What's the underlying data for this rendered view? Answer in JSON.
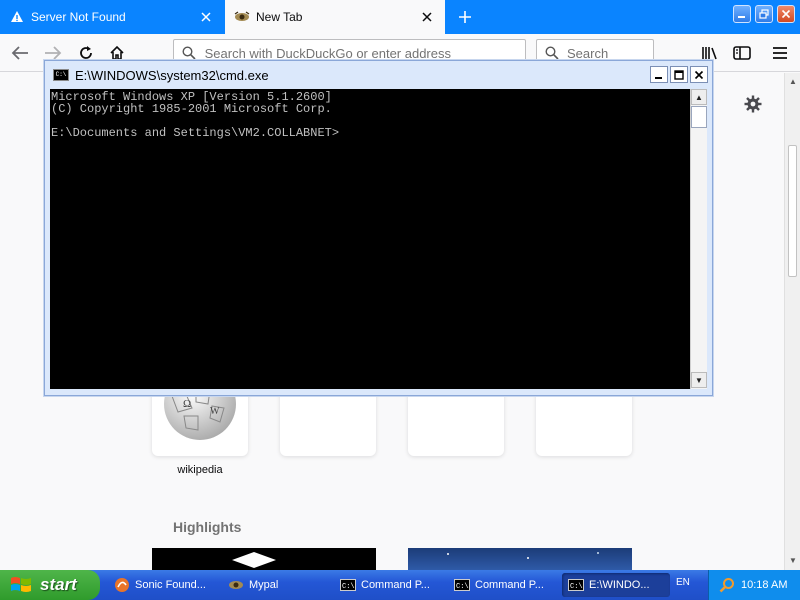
{
  "browser": {
    "tabs": [
      {
        "label": "Server Not Found",
        "icon": "warning-icon"
      },
      {
        "label": "New Tab",
        "icon": "newtab-favicon"
      }
    ],
    "urlbar_placeholder": "Search with DuckDuckGo or enter address",
    "searchbar_placeholder": "Search"
  },
  "newtab": {
    "top_sites": [
      {
        "label": "wikipedia",
        "icon": "wikipedia-globe-icon"
      },
      {
        "label": ""
      },
      {
        "label": ""
      },
      {
        "label": ""
      }
    ],
    "highlights_title": "Highlights"
  },
  "cmd": {
    "title": "E:\\WINDOWS\\system32\\cmd.exe",
    "icon_label": "C:\\",
    "lines": [
      "Microsoft Windows XP [Version 5.1.2600]",
      "(C) Copyright 1985-2001 Microsoft Corp.",
      "",
      "E:\\Documents and Settings\\VM2.COLLABNET>"
    ]
  },
  "taskbar": {
    "start_label": "start",
    "tasks": [
      {
        "label": "Sonic Found...",
        "icon": "sonic-foundry-icon"
      },
      {
        "label": "Mypal",
        "icon": "mypal-icon"
      },
      {
        "label": "Command P...",
        "icon": "cmd-icon"
      },
      {
        "label": "Command P...",
        "icon": "cmd-icon"
      },
      {
        "label": "E:\\WINDO...",
        "icon": "cmd-icon"
      }
    ],
    "language": "EN",
    "clock": "10:18 AM",
    "colors": {
      "taskbar": "#2457d6",
      "start": "#2f9b2c",
      "tray": "#0f8ded"
    }
  },
  "colors": {
    "tabstrip": "#0a84ff",
    "console_bg": "#000000",
    "console_text": "#c0c0c0"
  }
}
